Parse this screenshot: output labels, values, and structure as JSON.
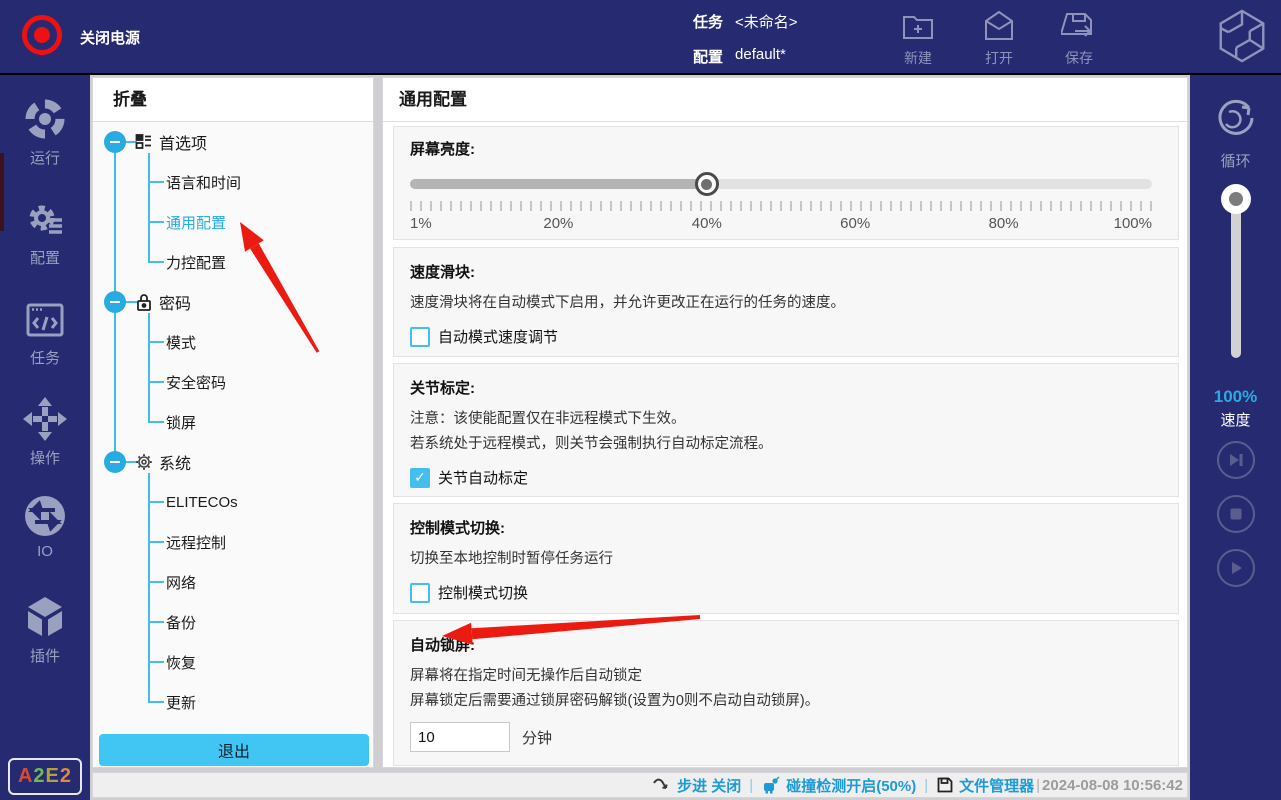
{
  "topbar": {
    "power_label": "关闭电源",
    "task_label": "任务",
    "task_value": "<未命名>",
    "config_label": "配置",
    "config_value": "default*",
    "actions": [
      {
        "label": "新建",
        "icon": "new-folder-plus-icon"
      },
      {
        "label": "打开",
        "icon": "open-envelope-icon"
      },
      {
        "label": "保存",
        "icon": "save-disk-arrow-icon"
      }
    ],
    "logo": "elite-cube-logo"
  },
  "left_nav": {
    "items": [
      {
        "label": "运行",
        "icon": "run-target-icon"
      },
      {
        "label": "配置",
        "icon": "config-gear-icon"
      },
      {
        "label": "任务",
        "icon": "task-code-window-icon"
      },
      {
        "label": "操作",
        "icon": "jog-move-arrows-icon"
      },
      {
        "label": "IO",
        "icon": "io-exchange-icon"
      },
      {
        "label": "插件",
        "icon": "plugin-cube-icon"
      }
    ],
    "badge": [
      {
        "ch": "A",
        "color": "#d94b30"
      },
      {
        "ch": "2",
        "color": "#6abf4b"
      },
      {
        "ch": "E",
        "color": "#b3a03b"
      },
      {
        "ch": "2",
        "color": "#d98a3d"
      }
    ]
  },
  "tree_panel": {
    "header": "折叠",
    "groups": [
      {
        "label": "首选项",
        "icon": "hierarchy-icon",
        "children": [
          "语言和时间",
          "通用配置",
          "力控配置"
        ]
      },
      {
        "label": "密码",
        "icon": "lock-icon",
        "children": [
          "模式",
          "安全密码",
          "锁屏"
        ]
      },
      {
        "label": "系统",
        "icon": "gear-icon",
        "children": [
          "ELITECOs",
          "远程控制",
          "网络",
          "备份",
          "恢复",
          "更新"
        ]
      }
    ],
    "selected_item": "通用配置",
    "exit_button": "退出"
  },
  "main": {
    "title": "通用配置",
    "brightness": {
      "label": "屏幕亮度:",
      "value_percent": 40,
      "scale_labels": [
        "1%",
        "20%",
        "40%",
        "60%",
        "80%",
        "100%"
      ]
    },
    "speed_slider": {
      "label": "速度滑块:",
      "desc": "速度滑块将在自动模式下启用，并允许更改正在运行的任务的速度。",
      "checkbox_label": "自动模式速度调节",
      "checked": false
    },
    "joint_calibration": {
      "label": "关节标定:",
      "desc1": "注意：该使能配置仅在非远程模式下生效。",
      "desc2": "若系统处于远程模式，则关节会强制执行自动标定流程。",
      "checkbox_label": "关节自动标定",
      "checked": true
    },
    "control_mode": {
      "label": "控制模式切换:",
      "desc": "切换至本地控制时暂停任务运行",
      "checkbox_label": "控制模式切换",
      "checked": false
    },
    "auto_lock": {
      "label": "自动锁屏:",
      "desc1": "屏幕将在指定时间无操作后自动锁定",
      "desc2": "屏幕锁定后需要通过锁屏密码解锁(设置为0则不启动自动锁屏)。",
      "input_value": "10",
      "unit": "分钟"
    }
  },
  "right_panel": {
    "loop_label": "循环",
    "speed_value": "100%",
    "speed_label": "速度",
    "buttons": [
      "skip-to-end-icon",
      "stop-icon",
      "play-icon"
    ]
  },
  "statusbar": {
    "step_label": "步进 关闭",
    "collision_label": "碰撞检测开启(50%)",
    "file_manager_label": "文件管理器",
    "timestamp": "2024-08-08 10:56:42"
  },
  "colors": {
    "topbar_navy": "#262a71",
    "accent_blue": "#29abe2",
    "exit_button_blue": "#41c5f2",
    "status_blue": "#1e9bd7",
    "annotation_red": "#ec1b12",
    "power_red": "#ee1111"
  }
}
